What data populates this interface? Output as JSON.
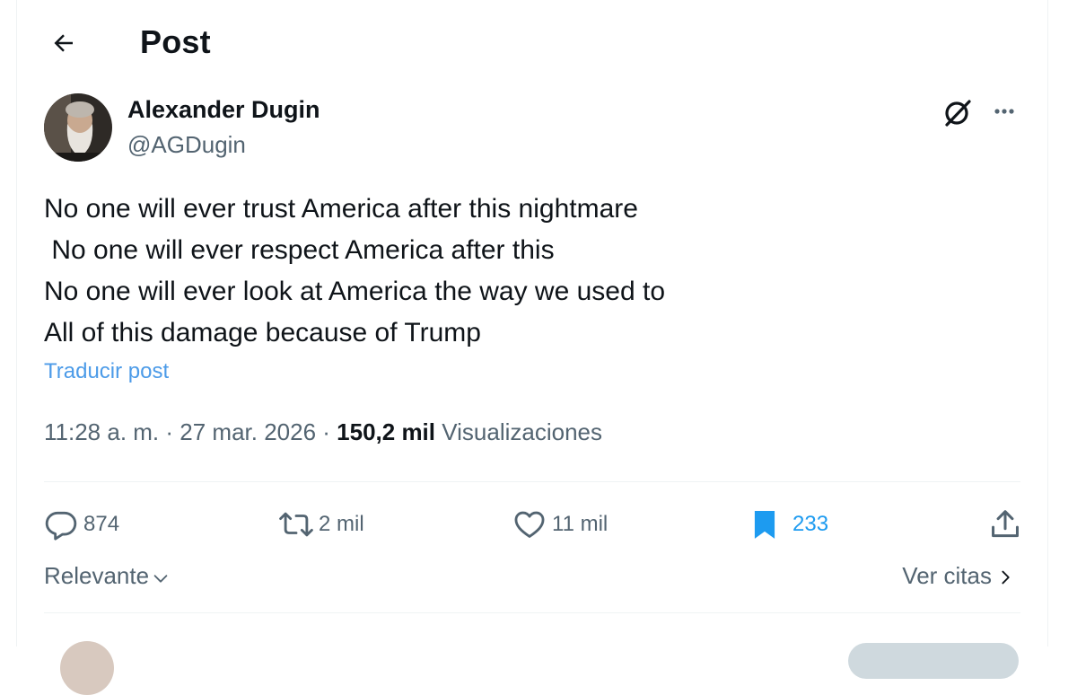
{
  "header": {
    "title": "Post"
  },
  "author": {
    "name": "Alexander Dugin",
    "handle": "@AGDugin"
  },
  "post": {
    "lines": [
      "No one will ever trust America after this nightmare",
      " No one will ever respect America after this",
      "No one will ever look at America the way we used to",
      "All of this damage because of Trump"
    ],
    "translate_label": "Traducir post",
    "time": "11:28 a. m.",
    "date": "27 mar. 2026",
    "views_count": "150,2 mil",
    "views_label": "Visualizaciones",
    "separator": " · "
  },
  "actions": {
    "replies": "874",
    "reposts": "2 mil",
    "likes": "11 mil",
    "bookmarks": "233"
  },
  "icons": {
    "back": "arrow-left-icon",
    "grok": "grok-icon",
    "more": "more-dots-icon",
    "reply": "reply-bubble-icon",
    "repost": "repost-icon",
    "like": "heart-icon",
    "bookmark": "bookmark-filled-icon",
    "share": "share-icon"
  },
  "colors": {
    "accent": "#1d9bf0",
    "link": "#4c9be8",
    "muted": "#536471",
    "text": "#0f1419"
  },
  "replies_bar": {
    "sort_label": "Relevante",
    "quotes_label": "Ver citas"
  }
}
